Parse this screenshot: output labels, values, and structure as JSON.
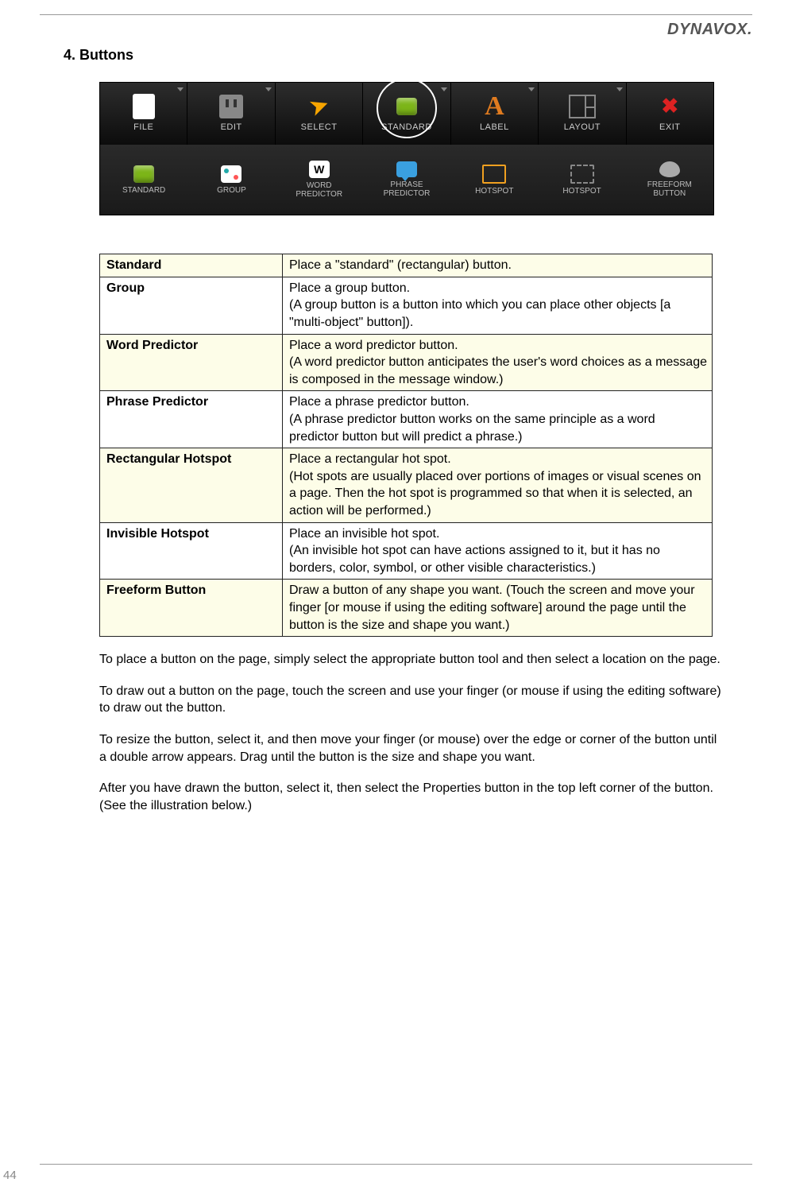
{
  "brand": "DYNAVOX.",
  "section_title": "4. Buttons",
  "toolbar_row1": [
    {
      "label": "FILE",
      "dropdown": true
    },
    {
      "label": "EDIT",
      "dropdown": true
    },
    {
      "label": "SELECT",
      "dropdown": false
    },
    {
      "label": "STANDARD",
      "dropdown": true,
      "highlight": true
    },
    {
      "label": "LABEL",
      "dropdown": true
    },
    {
      "label": "LAYOUT",
      "dropdown": true
    },
    {
      "label": "EXIT",
      "dropdown": false
    }
  ],
  "toolbar_row2": [
    {
      "label": "STANDARD"
    },
    {
      "label": "GROUP"
    },
    {
      "label": "WORD\nPREDICTOR",
      "letter": "W"
    },
    {
      "label": "PHRASE\nPREDICTOR"
    },
    {
      "label": "HOTSPOT"
    },
    {
      "label": "HOTSPOT"
    },
    {
      "label": "FREEFORM\nBUTTON"
    }
  ],
  "definitions": [
    {
      "term": "Standard",
      "desc": "Place a \"standard\" (rectangular) button.",
      "shade": true
    },
    {
      "term": "Group",
      "desc": "Place a group button.",
      "extra": "(A group button is a button into which you can place other objects [a \"multi-object\" button]).",
      "shade": false
    },
    {
      "term": "Word Predictor",
      "desc": "Place a word predictor button.",
      "extra": "(A word predictor button anticipates the user's word choices as a message is composed in the message window.)",
      "shade": true
    },
    {
      "term": "Phrase Predictor",
      "desc": "Place a phrase predictor button.",
      "extra": "(A phrase predictor button works on the same principle as a word predictor button but will predict a phrase.)",
      "shade": false
    },
    {
      "term": "Rectangular Hotspot",
      "desc": "Place a rectangular hot spot.",
      "extra": "(Hot spots are usually placed over portions of images or visual scenes on a page. Then the hot spot is programmed so that when it is selected, an action will be performed.)",
      "shade": true
    },
    {
      "term": "Invisible Hotspot",
      "desc": "Place an invisible hot spot.",
      "extra": "(An invisible hot spot can have actions assigned to it, but it has no borders, color, symbol, or other visible characteristics.)",
      "shade": false
    },
    {
      "term": "Freeform Button",
      "desc": "Draw a button of any shape you want. (Touch the screen and move your finger [or mouse if using the editing software] around the page until the button is the size and shape you want.)",
      "shade": true
    }
  ],
  "paragraphs": [
    "To place a button on the page, simply select the appropriate button tool and then select a location on the page.",
    "To draw out a button on the page, touch the screen and use your finger (or mouse if using the editing software) to draw out the button.",
    "To resize the button, select it, and then move your finger (or mouse) over the edge or corner of the button until a double arrow appears. Drag until the button is the size and shape you want.",
    "After you have drawn the button, select it, then select the Properties button in the top left corner of the button. (See the illustration below.)"
  ],
  "page_number": "44"
}
